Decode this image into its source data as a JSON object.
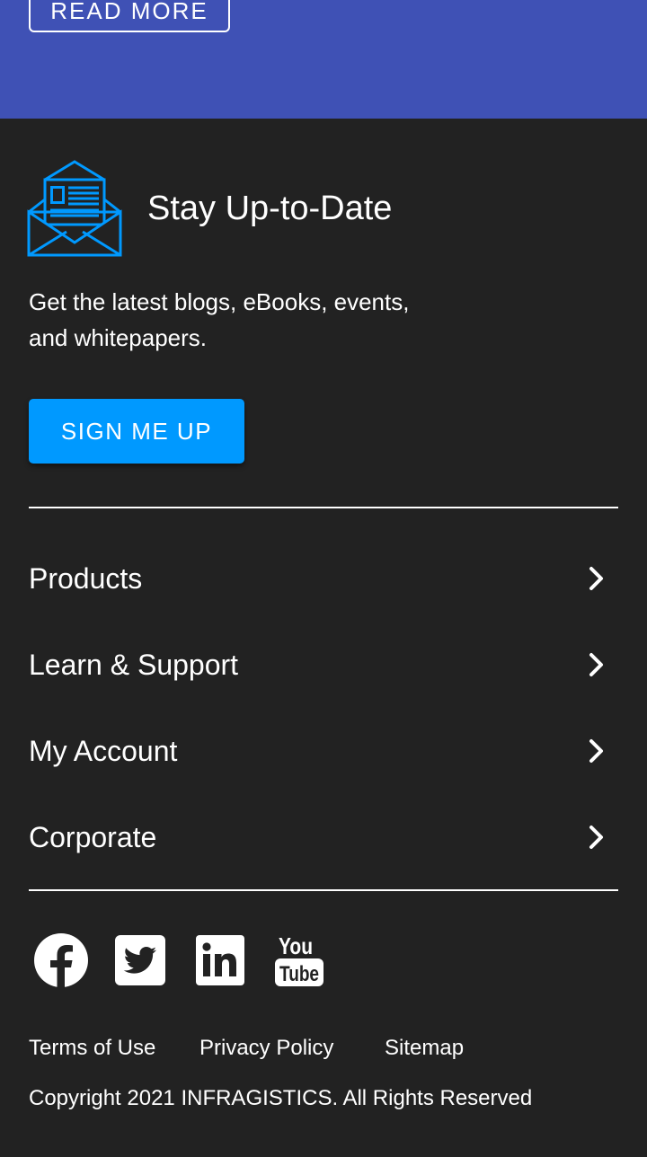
{
  "promo": {
    "read_more_label": "READ MORE"
  },
  "newsletter": {
    "title": "Stay Up-to-Date",
    "description": "Get the latest blogs, eBooks, events, and whitepapers.",
    "signup_label": "SIGN ME UP",
    "icon": "newsletter-envelope-icon"
  },
  "nav": {
    "items": [
      {
        "label": "Products",
        "icon": "chevron-right-icon"
      },
      {
        "label": "Learn & Support",
        "icon": "chevron-right-icon"
      },
      {
        "label": "My Account",
        "icon": "chevron-right-icon"
      },
      {
        "label": "Corporate",
        "icon": "chevron-right-icon"
      }
    ]
  },
  "social": {
    "items": [
      {
        "name": "facebook-icon"
      },
      {
        "name": "twitter-icon"
      },
      {
        "name": "linkedin-icon"
      },
      {
        "name": "youtube-icon",
        "text_top": "You",
        "text_bottom": "Tube"
      }
    ]
  },
  "legal": {
    "links": [
      {
        "label": "Terms of Use"
      },
      {
        "label": "Privacy Policy"
      },
      {
        "label": "Sitemap"
      }
    ],
    "copyright": "Copyright 2021 INFRAGISTICS. All Rights Reserved"
  },
  "colors": {
    "promo_background": "#3f51b5",
    "footer_background": "#222222",
    "accent_blue": "#0099ff",
    "text": "#ffffff"
  }
}
